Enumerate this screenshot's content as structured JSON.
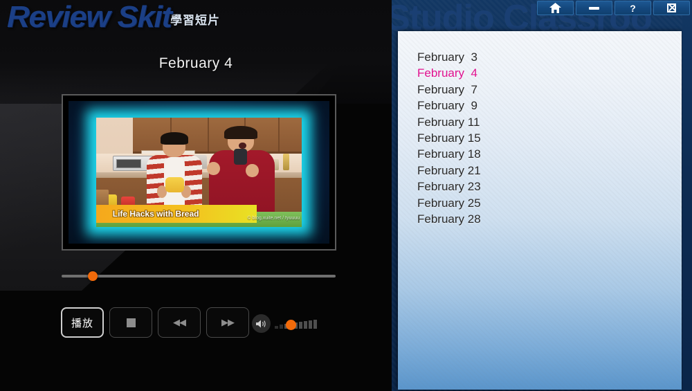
{
  "app": {
    "brand_main": "Review Skit",
    "brand_cjk": "學習短片",
    "watermark": "Studio Classroo"
  },
  "titlebar": {
    "buttons": [
      {
        "name": "home-button",
        "icon": "home-icon",
        "label": ""
      },
      {
        "name": "minimize-button",
        "icon": "minimize-icon",
        "label": ""
      },
      {
        "name": "help-button",
        "icon": "question-icon",
        "label": "?"
      },
      {
        "name": "close-button",
        "icon": "close-icon",
        "label": ""
      }
    ]
  },
  "player": {
    "date_heading": "February  4",
    "video": {
      "caption": "Life Hacks with Bread",
      "credit": "© blog.xuite.net / tyuuuu"
    },
    "progress": {
      "value_percent": 10
    },
    "controls": [
      {
        "name": "play-button",
        "label": "播放",
        "icon": "play-label",
        "active": true
      },
      {
        "name": "stop-button",
        "label": "",
        "icon": "stop-icon",
        "active": false
      },
      {
        "name": "rewind-button",
        "label": "◀◀",
        "icon": "rewind-icon",
        "active": false
      },
      {
        "name": "forward-button",
        "label": "▶▶",
        "icon": "fast-forward-icon",
        "active": false
      }
    ],
    "volume": {
      "icon": "speaker-icon",
      "value_percent": 22,
      "bar_count": 9
    }
  },
  "lesson_list": {
    "items": [
      {
        "label": "February  3",
        "selected": false
      },
      {
        "label": "February  4",
        "selected": true
      },
      {
        "label": "February  7",
        "selected": false
      },
      {
        "label": "February  9",
        "selected": false
      },
      {
        "label": "February 11",
        "selected": false
      },
      {
        "label": "February 15",
        "selected": false
      },
      {
        "label": "February 18",
        "selected": false
      },
      {
        "label": "February 21",
        "selected": false
      },
      {
        "label": "February 23",
        "selected": false
      },
      {
        "label": "February 25",
        "selected": false
      },
      {
        "label": "February 28",
        "selected": false
      }
    ]
  },
  "colors": {
    "accent_orange": "#f26a0a",
    "selected_magenta": "#e0118f",
    "brand_blue": "#1b3f86",
    "titlebar_blue": "#14477c",
    "glow_cyan": "#1ee0f5"
  }
}
